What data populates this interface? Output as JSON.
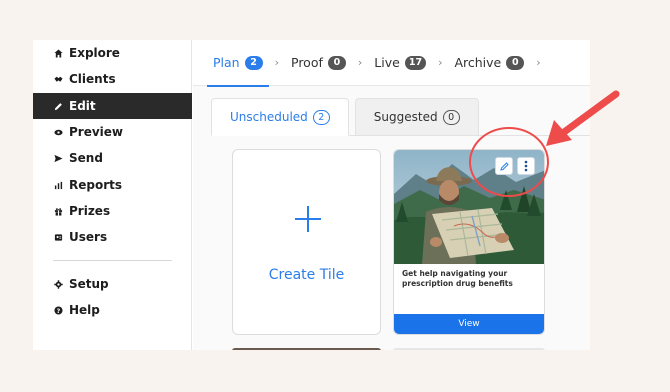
{
  "sidebar": {
    "items": [
      {
        "label": "Explore",
        "icon": "home-icon"
      },
      {
        "label": "Clients",
        "icon": "handshake-icon"
      },
      {
        "label": "Edit",
        "icon": "pencil-icon",
        "active": true
      },
      {
        "label": "Preview",
        "icon": "eye-icon"
      },
      {
        "label": "Send",
        "icon": "send-icon"
      },
      {
        "label": "Reports",
        "icon": "bar-chart-icon"
      },
      {
        "label": "Prizes",
        "icon": "gift-icon"
      },
      {
        "label": "Users",
        "icon": "users-icon"
      }
    ],
    "bottom_items": [
      {
        "label": "Setup",
        "icon": "gear-icon"
      },
      {
        "label": "Help",
        "icon": "help-icon"
      }
    ]
  },
  "stages": [
    {
      "label": "Plan",
      "count": "2",
      "active": true
    },
    {
      "label": "Proof",
      "count": "0"
    },
    {
      "label": "Live",
      "count": "17"
    },
    {
      "label": "Archive",
      "count": "0"
    }
  ],
  "tabs": [
    {
      "label": "Unscheduled",
      "count": "2",
      "active": true
    },
    {
      "label": "Suggested",
      "count": "0"
    }
  ],
  "create_tile": {
    "label": "Create Tile"
  },
  "tile": {
    "text": "Get help navigating your prescription drug benefits",
    "view_label": "View"
  },
  "colors": {
    "accent": "#2b7de9",
    "active_nav": "#2a2a2a",
    "callout": "#ee4b4b",
    "view_button": "#1a73e8"
  }
}
